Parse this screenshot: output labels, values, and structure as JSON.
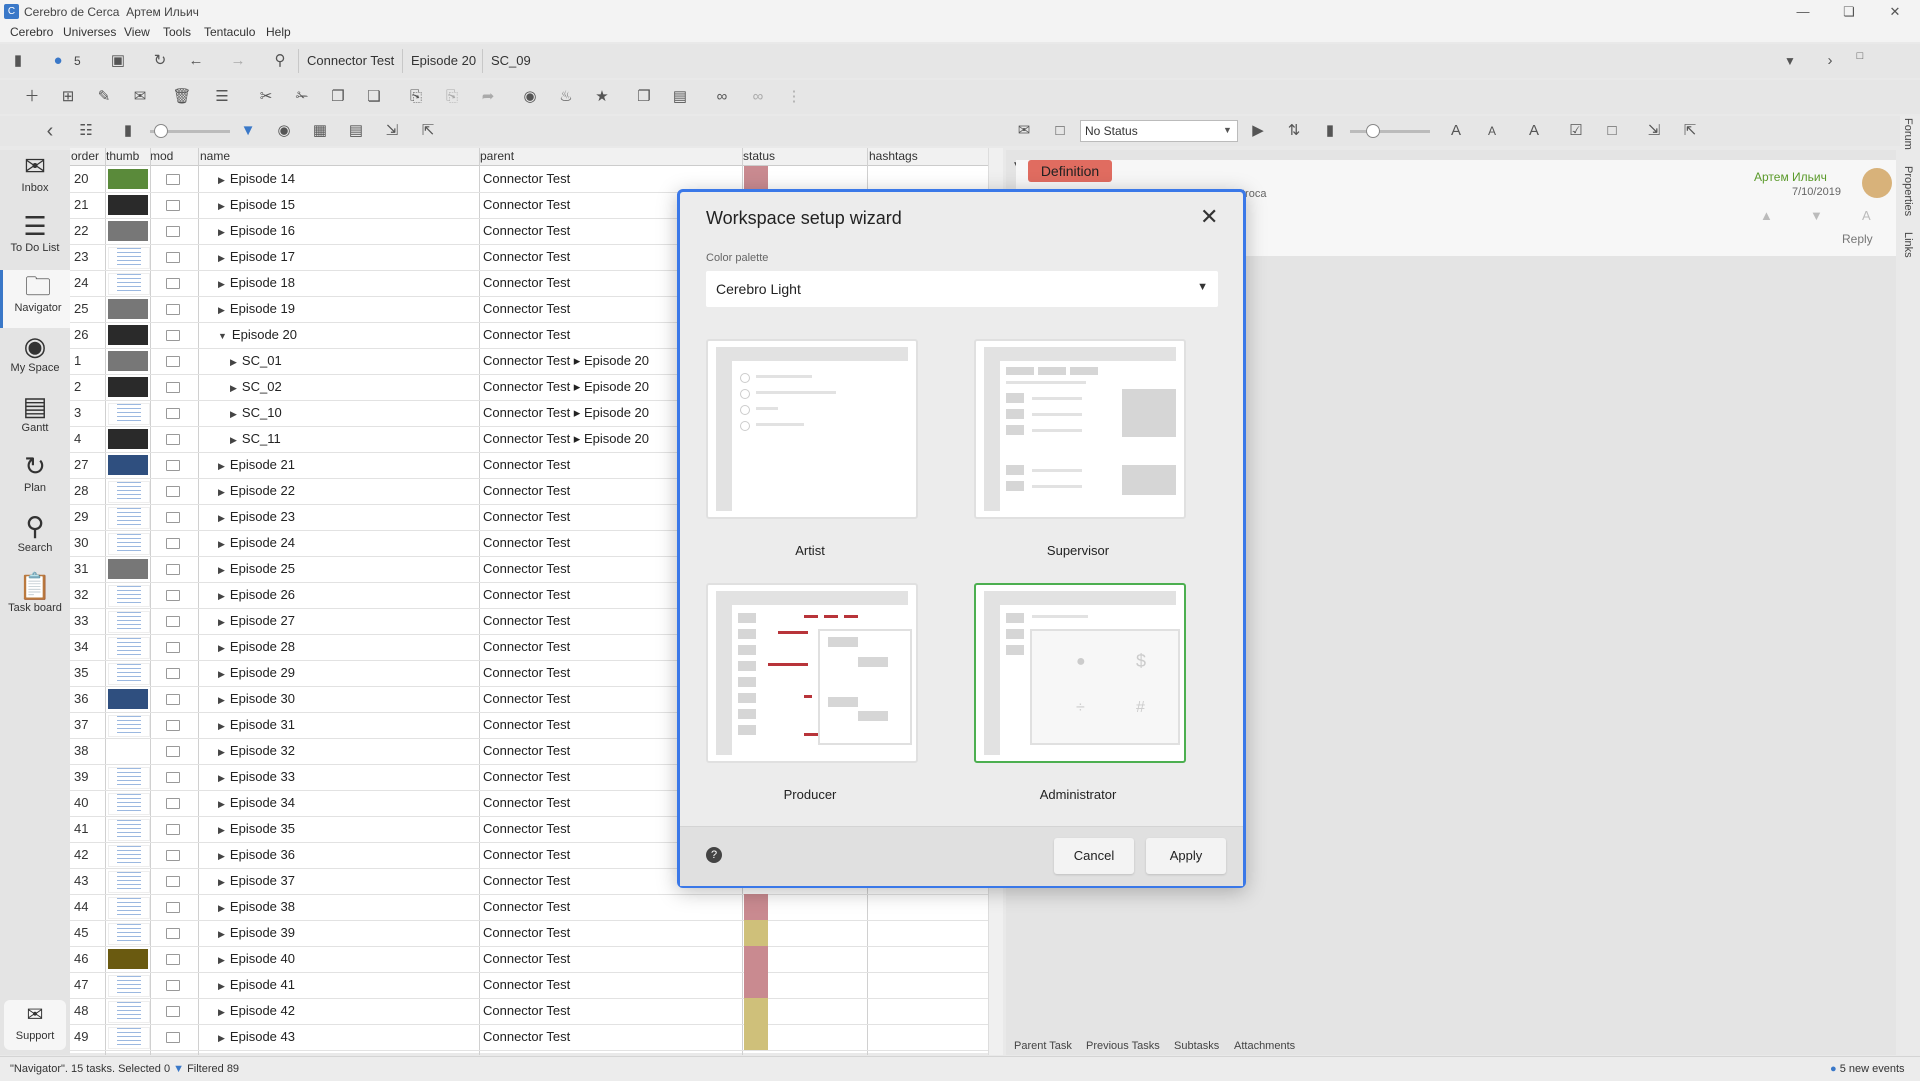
{
  "window": {
    "app_name": "Cerebro de Cerca",
    "user": "Артем Ильич"
  },
  "menu": [
    "Cerebro",
    "Universes",
    "View",
    "Tools",
    "Tentaculo",
    "Help"
  ],
  "toolbar": {
    "badge_count": "5",
    "breadcrumbs": [
      "Connector Test",
      "Episode 20",
      "SC_09"
    ],
    "status_filter": "No Status"
  },
  "sidebar": [
    {
      "label": "Inbox",
      "icon": "envelope-icon"
    },
    {
      "label": "To Do List",
      "icon": "list-icon"
    },
    {
      "label": "Navigator",
      "icon": "folder-icon"
    },
    {
      "label": "My Space",
      "icon": "globe-icon"
    },
    {
      "label": "Gantt",
      "icon": "gantt-icon"
    },
    {
      "label": "Plan",
      "icon": "plan-icon"
    },
    {
      "label": "Search",
      "icon": "search-icon"
    },
    {
      "label": "Task board",
      "icon": "clipboard-icon"
    }
  ],
  "support_label": "Support",
  "table": {
    "columns": [
      "order",
      "thumb",
      "mod",
      "name",
      "parent",
      "status",
      "hashtags"
    ],
    "rows": [
      {
        "order": "20",
        "name": "Episode 14",
        "parent": "Connector Test",
        "level": 0,
        "thumb": "green",
        "status": "#c98a90"
      },
      {
        "order": "21",
        "name": "Episode 15",
        "parent": "Connector Test",
        "level": 0,
        "thumb": "dark",
        "status": ""
      },
      {
        "order": "22",
        "name": "Episode 16",
        "parent": "Connector Test",
        "level": 0,
        "thumb": "grey",
        "status": ""
      },
      {
        "order": "23",
        "name": "Episode 17",
        "parent": "Connector Test",
        "level": 0,
        "thumb": "doc",
        "status": ""
      },
      {
        "order": "24",
        "name": "Episode 18",
        "parent": "Connector Test",
        "level": 0,
        "thumb": "doc",
        "status": ""
      },
      {
        "order": "25",
        "name": "Episode 19",
        "parent": "Connector Test",
        "level": 0,
        "thumb": "grey",
        "status": ""
      },
      {
        "order": "26",
        "name": "Episode 20",
        "parent": "Connector Test",
        "level": 0,
        "thumb": "dark",
        "status": "",
        "expanded": true
      },
      {
        "order": "1",
        "name": "SC_01",
        "parent": "Connector Test ▸ Episode 20",
        "level": 1,
        "thumb": "grey",
        "status": ""
      },
      {
        "order": "2",
        "name": "SC_02",
        "parent": "Connector Test ▸ Episode 20",
        "level": 1,
        "thumb": "dark",
        "status": ""
      },
      {
        "order": "3",
        "name": "SC_10",
        "parent": "Connector Test ▸ Episode 20",
        "level": 1,
        "thumb": "doc",
        "status": ""
      },
      {
        "order": "4",
        "name": "SC_11",
        "parent": "Connector Test ▸ Episode 20",
        "level": 1,
        "thumb": "dark",
        "status": ""
      },
      {
        "order": "27",
        "name": "Episode 21",
        "parent": "Connector Test",
        "level": 0,
        "thumb": "blue",
        "status": ""
      },
      {
        "order": "28",
        "name": "Episode 22",
        "parent": "Connector Test",
        "level": 0,
        "thumb": "doc",
        "status": ""
      },
      {
        "order": "29",
        "name": "Episode 23",
        "parent": "Connector Test",
        "level": 0,
        "thumb": "doc",
        "status": ""
      },
      {
        "order": "30",
        "name": "Episode 24",
        "parent": "Connector Test",
        "level": 0,
        "thumb": "doc",
        "status": ""
      },
      {
        "order": "31",
        "name": "Episode 25",
        "parent": "Connector Test",
        "level": 0,
        "thumb": "grey",
        "status": ""
      },
      {
        "order": "32",
        "name": "Episode 26",
        "parent": "Connector Test",
        "level": 0,
        "thumb": "doc",
        "status": ""
      },
      {
        "order": "33",
        "name": "Episode 27",
        "parent": "Connector Test",
        "level": 0,
        "thumb": "doc",
        "status": ""
      },
      {
        "order": "34",
        "name": "Episode 28",
        "parent": "Connector Test",
        "level": 0,
        "thumb": "doc",
        "status": ""
      },
      {
        "order": "35",
        "name": "Episode 29",
        "parent": "Connector Test",
        "level": 0,
        "thumb": "doc",
        "status": ""
      },
      {
        "order": "36",
        "name": "Episode 30",
        "parent": "Connector Test",
        "level": 0,
        "thumb": "blue",
        "status": ""
      },
      {
        "order": "37",
        "name": "Episode 31",
        "parent": "Connector Test",
        "level": 0,
        "thumb": "doc",
        "status": ""
      },
      {
        "order": "38",
        "name": "Episode 32",
        "parent": "Connector Test",
        "level": 0,
        "thumb": "none",
        "status": ""
      },
      {
        "order": "39",
        "name": "Episode 33",
        "parent": "Connector Test",
        "level": 0,
        "thumb": "doc",
        "status": ""
      },
      {
        "order": "40",
        "name": "Episode 34",
        "parent": "Connector Test",
        "level": 0,
        "thumb": "doc",
        "status": ""
      },
      {
        "order": "41",
        "name": "Episode 35",
        "parent": "Connector Test",
        "level": 0,
        "thumb": "doc",
        "status": ""
      },
      {
        "order": "42",
        "name": "Episode 36",
        "parent": "Connector Test",
        "level": 0,
        "thumb": "doc",
        "status": ""
      },
      {
        "order": "43",
        "name": "Episode 37",
        "parent": "Connector Test",
        "level": 0,
        "thumb": "doc",
        "status": ""
      },
      {
        "order": "44",
        "name": "Episode 38",
        "parent": "Connector Test",
        "level": 0,
        "thumb": "doc",
        "status": "#c98a90"
      },
      {
        "order": "45",
        "name": "Episode 39",
        "parent": "Connector Test",
        "level": 0,
        "thumb": "doc",
        "status": "#cfc07a"
      },
      {
        "order": "46",
        "name": "Episode 40",
        "parent": "Connector Test",
        "level": 0,
        "thumb": "yellow",
        "status": "#c98a90"
      },
      {
        "order": "47",
        "name": "Episode 41",
        "parent": "Connector Test",
        "level": 0,
        "thumb": "doc",
        "status": "#c98a90"
      },
      {
        "order": "48",
        "name": "Episode 42",
        "parent": "Connector Test",
        "level": 0,
        "thumb": "doc",
        "status": "#cfc07a"
      },
      {
        "order": "49",
        "name": "Episode 43",
        "parent": "Connector Test",
        "level": 0,
        "thumb": "doc",
        "status": "#cfc07a"
      }
    ]
  },
  "right_panel": {
    "tag": "Definition",
    "comment_author": "Артем Ильич",
    "comment_date": "7/10/2019",
    "comment_fragment": "troca",
    "reply": "Reply",
    "bottom_tabs": [
      "Parent Task",
      "Previous Tasks",
      "Subtasks",
      "Attachments"
    ],
    "side_tabs": [
      "Forum",
      "Properties",
      "Links"
    ]
  },
  "statusbar": {
    "left": "\"Navigator\". 15 tasks. Selected 0",
    "filter": "Filtered 89",
    "right": "5 new events"
  },
  "modal": {
    "title": "Workspace setup wizard",
    "palette_label": "Color palette",
    "palette_value": "Cerebro Light",
    "options": [
      "Artist",
      "Supervisor",
      "Producer",
      "Administrator"
    ],
    "selected": "Administrator",
    "cancel": "Cancel",
    "apply": "Apply"
  },
  "colors": {
    "accent": "#3a78e8",
    "selected_card": "#4caf50",
    "definition": "#e06c60",
    "author": "#5a9a2a"
  }
}
